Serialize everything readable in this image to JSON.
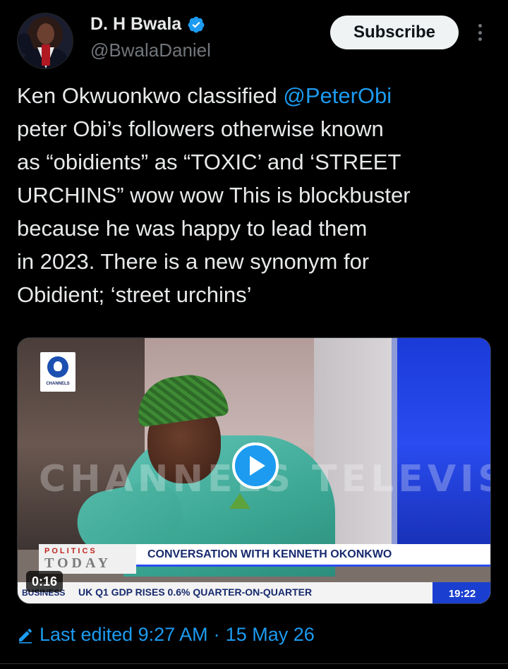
{
  "author": {
    "display_name": "D. H Bwala",
    "handle": "@BwalaDaniel",
    "verified": true,
    "avatar_icon": "profile-photo"
  },
  "header": {
    "subscribe_label": "Subscribe",
    "more_icon": "vertical-ellipsis-icon"
  },
  "tweet": {
    "lines": [
      {
        "pre": "Ken Okwuonkwo classified ",
        "mention": "@PeterObi"
      },
      {
        "pre": "peter Obi’s followers  otherwise known"
      },
      {
        "pre": "as “obidients” as “TOXIC’ and ‘STREET"
      },
      {
        "pre": "URCHINS” wow wow This is blockbuster"
      },
      {
        "pre": "because he was happy to lead them"
      },
      {
        "pre": "in 2023. There is a new synonym for"
      },
      {
        "pre": "Obidient; ‘street urchins’"
      }
    ]
  },
  "video": {
    "duration": "0:16",
    "play_icon": "play-icon",
    "channel_logo_text": "CHANNELS",
    "watermark": "CHANNELS TELEVISION",
    "program_top": "POLITICS",
    "program_bottom": "TODAY",
    "headline": "CONVERSATION WITH KENNETH OKONKWO",
    "ticker_label": "BUSINESS",
    "ticker_text": "UK Q1 GDP RISES 0.6% QUARTER-ON-QUARTER",
    "ticker_time": "19:22"
  },
  "footer": {
    "edited_label": "Last edited 9:27 AM",
    "separator": "·",
    "date": "15 May 26",
    "pencil_icon": "edit-pencil-icon"
  },
  "colors": {
    "background": "#000000",
    "accent": "#1d9bf0",
    "text": "#e7e9ea",
    "muted": "#71767b"
  }
}
